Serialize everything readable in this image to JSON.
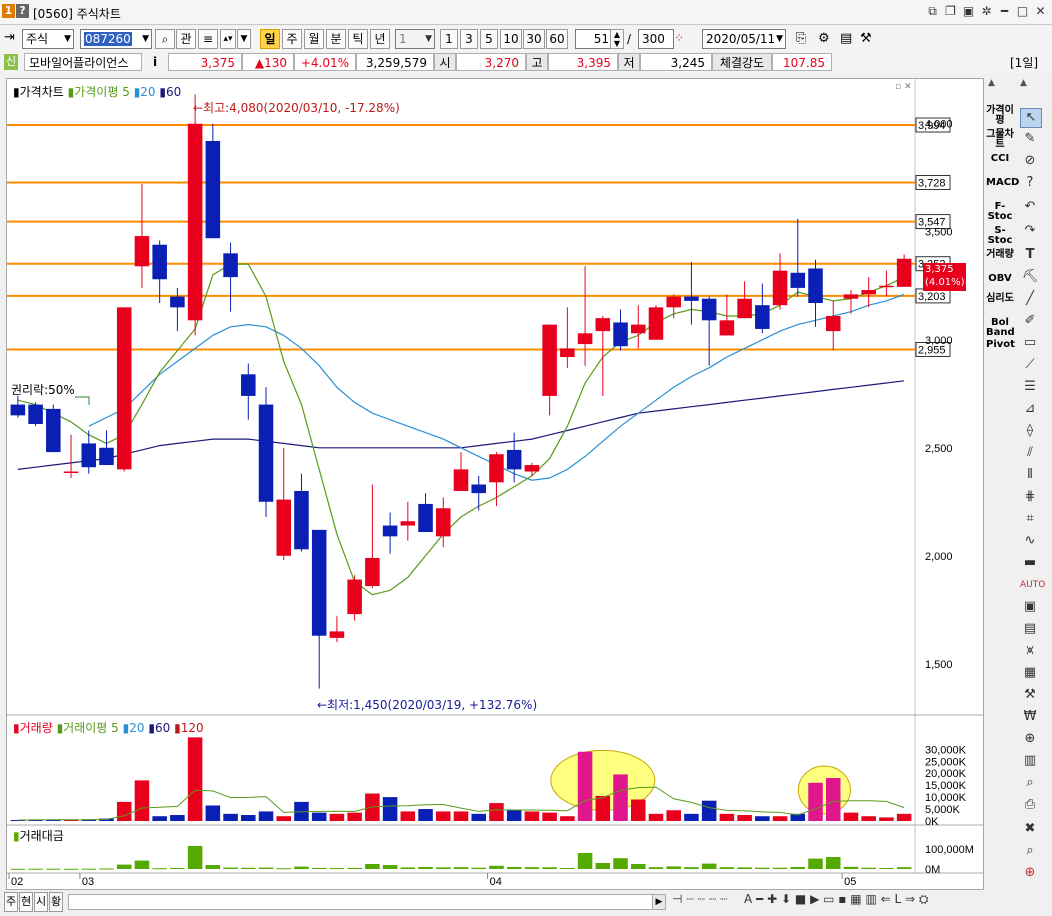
{
  "window": {
    "screen_no": "1",
    "help": "?",
    "title": "[0560] 주식차트"
  },
  "toolbar": {
    "market": "주식",
    "code": "087260",
    "btn_kwan": "관",
    "period_buttons": [
      "일",
      "주",
      "월",
      "분",
      "틱",
      "년"
    ],
    "interval_select": "1",
    "interval_buttons": [
      "1",
      "3",
      "5",
      "10",
      "30",
      "60"
    ],
    "view_count": "51",
    "slash": "/",
    "total_count": "300",
    "date": "2020/05/11"
  },
  "quote": {
    "badge": "신",
    "name": "모바일어플라이언스",
    "info": "i",
    "price": "3,375",
    "change": "▲130",
    "change_pct": "+4.01%",
    "volume": "3,259,579",
    "open_label": "시",
    "open": "3,270",
    "high_label": "고",
    "high": "3,395",
    "low_label": "저",
    "low": "3,245",
    "strength_label": "체결강도",
    "strength": "107.85",
    "period_tag": "[1일]"
  },
  "price_panel": {
    "legend": [
      "가격차트",
      "가격이평",
      "5",
      "20",
      "60"
    ],
    "high_annotation": "←최고:4,080(2020/03/10, -17.28%)",
    "low_annotation": "←최저:1,450(2020/03/19, +132.76%)",
    "rights_annotation": "권리락:50%",
    "current_price_tag": "3,375",
    "current_pct_tag": "(4.01%)"
  },
  "volume_panel": {
    "legend": [
      "거래량",
      "거래이평",
      "5",
      "20",
      "60",
      "120"
    ]
  },
  "amount_panel": {
    "legend": [
      "거래대금"
    ]
  },
  "indicators": [
    "가격이평",
    "그물차트",
    "CCI",
    "MACD",
    "F-Stoc",
    "S-Stoc",
    "거래량",
    "OBV",
    "심리도",
    "Bol Band",
    "Pivot"
  ],
  "bottom_tabs": [
    "주",
    "현",
    "시",
    "황"
  ],
  "colors": {
    "up": "#e8001c",
    "down": "#0a1fb4",
    "ma5": "#5a9a1a",
    "ma20": "#2a8fd6",
    "ma60": "#1a1a7a",
    "level_line": "#ff8c00",
    "highlight": "#ffff80",
    "amount": "#55aa00"
  },
  "chart_data": {
    "type": "candlestick",
    "x_ticks": [
      "02",
      "03",
      "04",
      "05"
    ],
    "y_ticks": [
      1500,
      2000,
      2500,
      3000,
      3500,
      4000
    ],
    "y_tick_labels": [
      "1,500",
      "2,000",
      "2,500",
      "3,000",
      "3,500",
      "4,000"
    ],
    "ylim": [
      1300,
      4170
    ],
    "levels": [
      3994,
      3728,
      3547,
      3352,
      3203,
      2955
    ],
    "level_labels": [
      "3,994",
      "3,728",
      "3,547",
      "3,352",
      "3,203",
      "2,955"
    ],
    "candles": [
      {
        "o": 2700,
        "h": 2740,
        "l": 2640,
        "c": 2650
      },
      {
        "o": 2700,
        "h": 2710,
        "l": 2600,
        "c": 2610
      },
      {
        "o": 2680,
        "h": 2700,
        "l": 2480,
        "c": 2480
      },
      {
        "o": 2390,
        "h": 2560,
        "l": 2360,
        "c": 2390
      },
      {
        "o": 2520,
        "h": 2580,
        "l": 2380,
        "c": 2410
      },
      {
        "o": 2500,
        "h": 2580,
        "l": 2420,
        "c": 2420
      },
      {
        "o": 2400,
        "h": 3150,
        "l": 2390,
        "c": 3150
      },
      {
        "o": 3340,
        "h": 3720,
        "l": 3240,
        "c": 3480
      },
      {
        "o": 3440,
        "h": 3460,
        "l": 3170,
        "c": 3280
      },
      {
        "o": 3200,
        "h": 3240,
        "l": 3040,
        "c": 3150
      },
      {
        "o": 3090,
        "h": 4080,
        "l": 3020,
        "c": 4000
      },
      {
        "o": 3920,
        "h": 4000,
        "l": 3470,
        "c": 3470
      },
      {
        "o": 3400,
        "h": 3450,
        "l": 3130,
        "c": 3290
      },
      {
        "o": 2840,
        "h": 2890,
        "l": 2630,
        "c": 2740
      },
      {
        "o": 2700,
        "h": 2780,
        "l": 2180,
        "c": 2250
      },
      {
        "o": 2000,
        "h": 2500,
        "l": 1980,
        "c": 2260
      },
      {
        "o": 2300,
        "h": 2380,
        "l": 2020,
        "c": 2030
      },
      {
        "o": 2120,
        "h": 2120,
        "l": 1450,
        "c": 1630
      },
      {
        "o": 1620,
        "h": 1720,
        "l": 1600,
        "c": 1650
      },
      {
        "o": 1730,
        "h": 1910,
        "l": 1700,
        "c": 1890
      },
      {
        "o": 1860,
        "h": 2330,
        "l": 1850,
        "c": 1990
      },
      {
        "o": 2140,
        "h": 2200,
        "l": 2010,
        "c": 2090
      },
      {
        "o": 2140,
        "h": 2250,
        "l": 2070,
        "c": 2160
      },
      {
        "o": 2240,
        "h": 2290,
        "l": 2110,
        "c": 2110
      },
      {
        "o": 2090,
        "h": 2270,
        "l": 2040,
        "c": 2220
      },
      {
        "o": 2300,
        "h": 2480,
        "l": 2300,
        "c": 2400
      },
      {
        "o": 2330,
        "h": 2370,
        "l": 2210,
        "c": 2290
      },
      {
        "o": 2340,
        "h": 2480,
        "l": 2230,
        "c": 2470
      },
      {
        "o": 2490,
        "h": 2570,
        "l": 2340,
        "c": 2400
      },
      {
        "o": 2390,
        "h": 2430,
        "l": 2370,
        "c": 2420
      },
      {
        "o": 2740,
        "h": 3020,
        "l": 2650,
        "c": 3070
      },
      {
        "o": 2920,
        "h": 3150,
        "l": 2870,
        "c": 2960
      },
      {
        "o": 2980,
        "h": 3340,
        "l": 2880,
        "c": 3030
      },
      {
        "o": 3040,
        "h": 3110,
        "l": 2740,
        "c": 3100
      },
      {
        "o": 3080,
        "h": 3140,
        "l": 2950,
        "c": 2970
      },
      {
        "o": 3030,
        "h": 3160,
        "l": 2960,
        "c": 3070
      },
      {
        "o": 3000,
        "h": 3160,
        "l": 3000,
        "c": 3150
      },
      {
        "o": 3150,
        "h": 3210,
        "l": 3100,
        "c": 3200
      },
      {
        "o": 3200,
        "h": 3360,
        "l": 3070,
        "c": 3180
      },
      {
        "o": 3190,
        "h": 3200,
        "l": 2880,
        "c": 3090
      },
      {
        "o": 3020,
        "h": 3210,
        "l": 3020,
        "c": 3090
      },
      {
        "o": 3100,
        "h": 3270,
        "l": 3100,
        "c": 3190
      },
      {
        "o": 3160,
        "h": 3260,
        "l": 3030,
        "c": 3050
      },
      {
        "o": 3160,
        "h": 3400,
        "l": 3140,
        "c": 3320
      },
      {
        "o": 3310,
        "h": 3560,
        "l": 3200,
        "c": 3240
      },
      {
        "o": 3330,
        "h": 3370,
        "l": 3060,
        "c": 3170
      },
      {
        "o": 3040,
        "h": 3180,
        "l": 2950,
        "c": 3110
      },
      {
        "o": 3190,
        "h": 3230,
        "l": 3120,
        "c": 3210
      },
      {
        "o": 3210,
        "h": 3290,
        "l": 3150,
        "c": 3230
      },
      {
        "o": 3250,
        "h": 3320,
        "l": 3200,
        "c": 3250
      },
      {
        "o": 3245,
        "h": 3395,
        "l": 3245,
        "c": 3375
      }
    ],
    "ma5": [
      2720,
      2700,
      2660,
      2620,
      2560,
      2520,
      2560,
      2700,
      2850,
      2950,
      3050,
      3300,
      3350,
      3350,
      3200,
      2900,
      2700,
      2400,
      2100,
      1880,
      1820,
      1840,
      1900,
      2000,
      2100,
      2180,
      2230,
      2270,
      2320,
      2370,
      2450,
      2600,
      2800,
      2920,
      2990,
      3020,
      3080,
      3120,
      3140,
      3130,
      3110,
      3110,
      3120,
      3160,
      3220,
      3200,
      3180,
      3190,
      3220,
      3250,
      3290
    ],
    "ma20": [
      null,
      null,
      null,
      null,
      2600,
      2640,
      2680,
      2760,
      2840,
      2900,
      2960,
      3020,
      3060,
      3070,
      3060,
      3020,
      2960,
      2880,
      2780,
      2710,
      2660,
      2630,
      2600,
      2570,
      2540,
      2500,
      2460,
      2420,
      2380,
      2350,
      2360,
      2400,
      2460,
      2530,
      2600,
      2660,
      2720,
      2780,
      2830,
      2870,
      2920,
      2960,
      3000,
      3040,
      3070,
      3090,
      3110,
      3130,
      3160,
      3180,
      3210
    ],
    "ma60": [
      2400,
      2410,
      2420,
      2430,
      2440,
      2450,
      2470,
      2490,
      2510,
      2520,
      2530,
      2540,
      2540,
      2540,
      2530,
      2520,
      2510,
      2500,
      2500,
      2500,
      2500,
      2500,
      2500,
      2500,
      2500,
      2500,
      2510,
      2520,
      2530,
      2540,
      2560,
      2580,
      2600,
      2620,
      2640,
      2660,
      2670,
      2680,
      2690,
      2700,
      2710,
      2720,
      2730,
      2740,
      2750,
      2760,
      2770,
      2780,
      2790,
      2800,
      2810
    ],
    "volume_ylim": [
      0,
      36000
    ],
    "volume_tick_labels": [
      "30,000K",
      "25,000K",
      "20,000K",
      "15,000K",
      "10,000K",
      "5,000K",
      "0K"
    ],
    "volume_tick_values": [
      30000,
      25000,
      20000,
      15000,
      10000,
      5000,
      0
    ],
    "volume": [
      400,
      500,
      600,
      500,
      700,
      1000,
      8000,
      17000,
      2000,
      2500,
      35000,
      6500,
      3000,
      2500,
      4000,
      2000,
      8000,
      3500,
      3000,
      3500,
      11500,
      10000,
      4000,
      5000,
      4000,
      4000,
      3000,
      7500,
      4500,
      4000,
      3500,
      2000,
      29000,
      10500,
      19500,
      9000,
      3000,
      4500,
      3000,
      8500,
      3000,
      2500,
      2000,
      2000,
      3000,
      16000,
      18000,
      3500,
      2000,
      1500,
      3000
    ],
    "amount_tick_labels": [
      "100,000M",
      "0M"
    ],
    "amount_tick_values": [
      100000,
      0
    ],
    "amount_ylim": [
      0,
      140000
    ],
    "amount": [
      1000,
      1500,
      1500,
      1200,
      1600,
      2500,
      22000,
      42000,
      4000,
      5000,
      115000,
      20000,
      7000,
      6000,
      7000,
      4000,
      12000,
      5000,
      4500,
      5500,
      25000,
      20000,
      8000,
      10000,
      8000,
      9000,
      6500,
      16000,
      10000,
      9000,
      8500,
      5000,
      80000,
      30000,
      54000,
      25000,
      9000,
      13000,
      9000,
      27000,
      9000,
      8000,
      6500,
      6500,
      10000,
      52000,
      60000,
      11000,
      6500,
      5000,
      9000
    ]
  }
}
